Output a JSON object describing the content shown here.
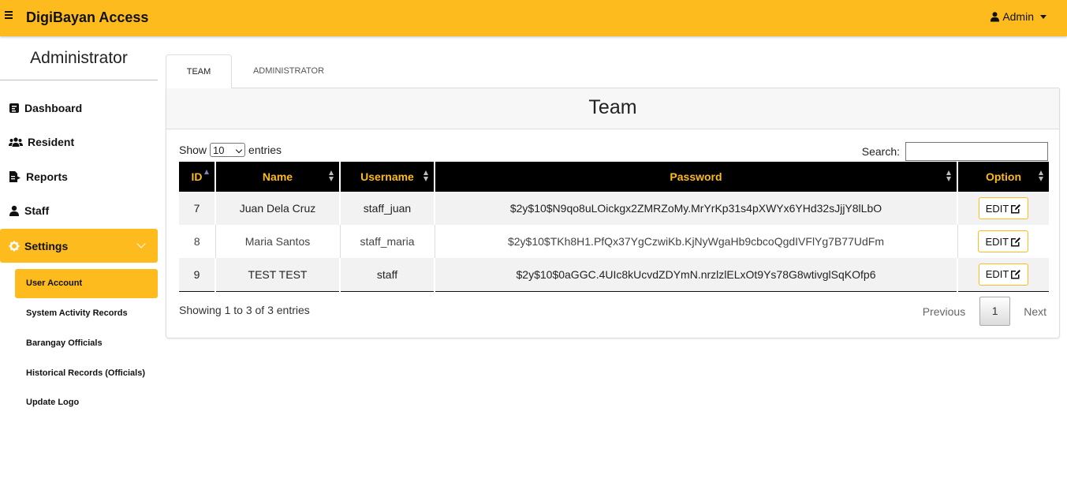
{
  "app": {
    "brand": "DigiBayan Access",
    "user_label": "Admin"
  },
  "sidebar": {
    "title": "Administrator",
    "items": [
      {
        "label": "Dashboard",
        "icon": "dashboard-icon"
      },
      {
        "label": "Resident",
        "icon": "users-icon"
      },
      {
        "label": "Reports",
        "icon": "report-icon"
      },
      {
        "label": "Staff",
        "icon": "user-icon"
      },
      {
        "label": "Settings",
        "icon": "gear-icon",
        "active": true
      }
    ],
    "sub_items": [
      {
        "label": "User Account",
        "active": true
      },
      {
        "label": "System Activity Records"
      },
      {
        "label": "Barangay Officials"
      },
      {
        "label": "Historical Records (Officials)"
      },
      {
        "label": "Update Logo"
      }
    ]
  },
  "tabs": [
    {
      "label": "TEAM",
      "active": true
    },
    {
      "label": "ADMINISTRATOR"
    }
  ],
  "card": {
    "title": "Team"
  },
  "table_controls": {
    "show_label": "Show",
    "entries_value": "10",
    "entries_label": "entries",
    "search_label": "Search:"
  },
  "table": {
    "columns": [
      "ID",
      "Name",
      "Username",
      "Password",
      "Option"
    ],
    "rows": [
      {
        "id": "7",
        "name": "Juan Dela Cruz",
        "username": "staff_juan",
        "password": "$2y$10$N9qo8uLOickgx2ZMRZoMy.MrYrKp31s4pXWYx6YHd32sJjjY8lLbO",
        "option": "EDIT"
      },
      {
        "id": "8",
        "name": "Maria Santos",
        "username": "staff_maria",
        "password": "$2y$10$TKh8H1.PfQx37YgCzwiKb.KjNyWgaHb9cbcoQgdIVFlYg7B77UdFm",
        "option": "EDIT"
      },
      {
        "id": "9",
        "name": "TEST TEST",
        "username": "staff",
        "password": "$2y$10$0aGGC.4UIc8kUcvdZDYmN.nrzlzlELxOt9Ys78G8wtivglSqKOfp6",
        "option": "EDIT"
      }
    ]
  },
  "footer": {
    "info": "Showing 1 to 3 of 3 entries",
    "previous": "Previous",
    "page": "1",
    "next": "Next"
  },
  "colors": {
    "accent": "#fdbb1e",
    "header_bg": "#000000"
  }
}
